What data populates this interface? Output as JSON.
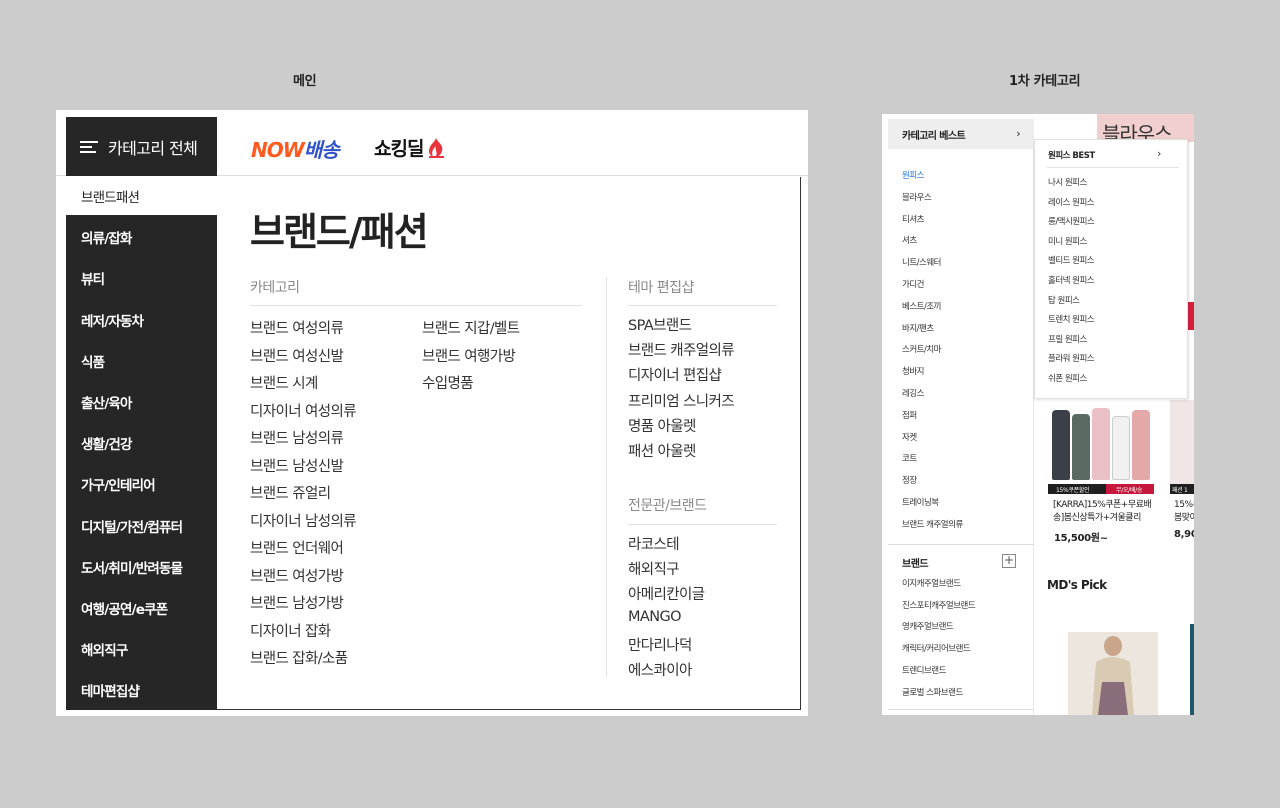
{
  "captions": {
    "main": "메인",
    "category": "1차 카테고리"
  },
  "header": {
    "all_category_label": "카테고리 전체",
    "logo_now": "NOW",
    "logo_now_suffix": "배송",
    "logo_shopping": "쇼킹딜"
  },
  "sidebar": {
    "items": [
      {
        "label": "브랜드패션",
        "active": true
      },
      {
        "label": "의류/잡화"
      },
      {
        "label": "뷰티"
      },
      {
        "label": "레저/자동차"
      },
      {
        "label": "식품"
      },
      {
        "label": "출산/육아"
      },
      {
        "label": "생활/건강"
      },
      {
        "label": "가구/인테리어"
      },
      {
        "label": "디지털/가전/컴퓨터"
      },
      {
        "label": "도서/취미/반려동물"
      },
      {
        "label": "여행/공연/e쿠폰"
      },
      {
        "label": "해외직구"
      },
      {
        "label": "테마편집샵"
      }
    ]
  },
  "content": {
    "title": "브랜드/패션",
    "category_header": "카테고리",
    "category_col1": [
      "브랜드 여성의류",
      "브랜드 여성신발",
      "브랜드 시계",
      "디자이너 여성의류",
      "브랜드 남성의류",
      "브랜드 남성신발",
      "브랜드 쥬얼리",
      "디자이너 남성의류",
      "브랜드 언더웨어",
      "브랜드 여성가방",
      "브랜드 남성가방",
      "디자이너 잡화",
      "브랜드 잡화/소품"
    ],
    "category_col2": [
      "브랜드 지갑/벨트",
      "브랜드 여행가방",
      "수입명품"
    ],
    "theme_header": "테마 편집샵",
    "theme_links": [
      "SPA브랜드",
      "브랜드 캐주얼의류",
      "디자이너 편집샵",
      "프리미엄 스니커즈",
      "명품 아울렛",
      "패션 아울렛"
    ],
    "specialty_header": "전문관/브랜드",
    "specialty_links": [
      "라코스테",
      "해외직구",
      "아메리칸이글",
      "MANGO",
      "만다리나덕",
      "에스콰이아"
    ]
  },
  "category_panel": {
    "best_label": "카테고리 베스트",
    "items": [
      "원피스",
      "블라우스",
      "티셔츠",
      "셔츠",
      "니트/스웨터",
      "가디건",
      "베스트/조끼",
      "바지/팬츠",
      "스커트/치마",
      "청바지",
      "레깅스",
      "점퍼",
      "자켓",
      "코트",
      "정장",
      "트레이닝복",
      "브랜드 캐주얼의류"
    ],
    "brand_header": "브랜드",
    "brand_items": [
      "이지캐주얼브랜드",
      "진스포티캐주얼브랜드",
      "영캐주얼브랜드",
      "캐릭터/커리어브랜드",
      "트렌디브랜드",
      "글로벌 스파브랜드"
    ],
    "submenu": {
      "head": "원피스 BEST",
      "items": [
        "나시 원피스",
        "레이스 원피스",
        "롱/맥시원피스",
        "미니 원피스",
        "벨티드 원피스",
        "홀터넥 원피스",
        "탑 원피스",
        "트렌치 원피스",
        "프릴 원피스",
        "플라워 원피스",
        "쉬폰 원피스"
      ]
    },
    "background_title": "블라우스",
    "product": {
      "badge_left": "15%쿠폰할인",
      "badge_right": "무/오/배/송",
      "badge_partial": "패션 1",
      "name_line1": "[KARRA]15%쿠폰+무료배",
      "name_line2": "송]봄신상특가+겨울클리",
      "price": "15,500원~",
      "name2_line1": "15%쿠",
      "name2_line2": "봄맞이",
      "price2": "8,90"
    },
    "mds_pick": "MD's Pick"
  },
  "colors": {
    "dark": "#262626",
    "now_orange": "#ff5a1f",
    "now_blue": "#2f52c8",
    "active_blue": "#1e6fd9",
    "badge_red": "#c6183c"
  }
}
